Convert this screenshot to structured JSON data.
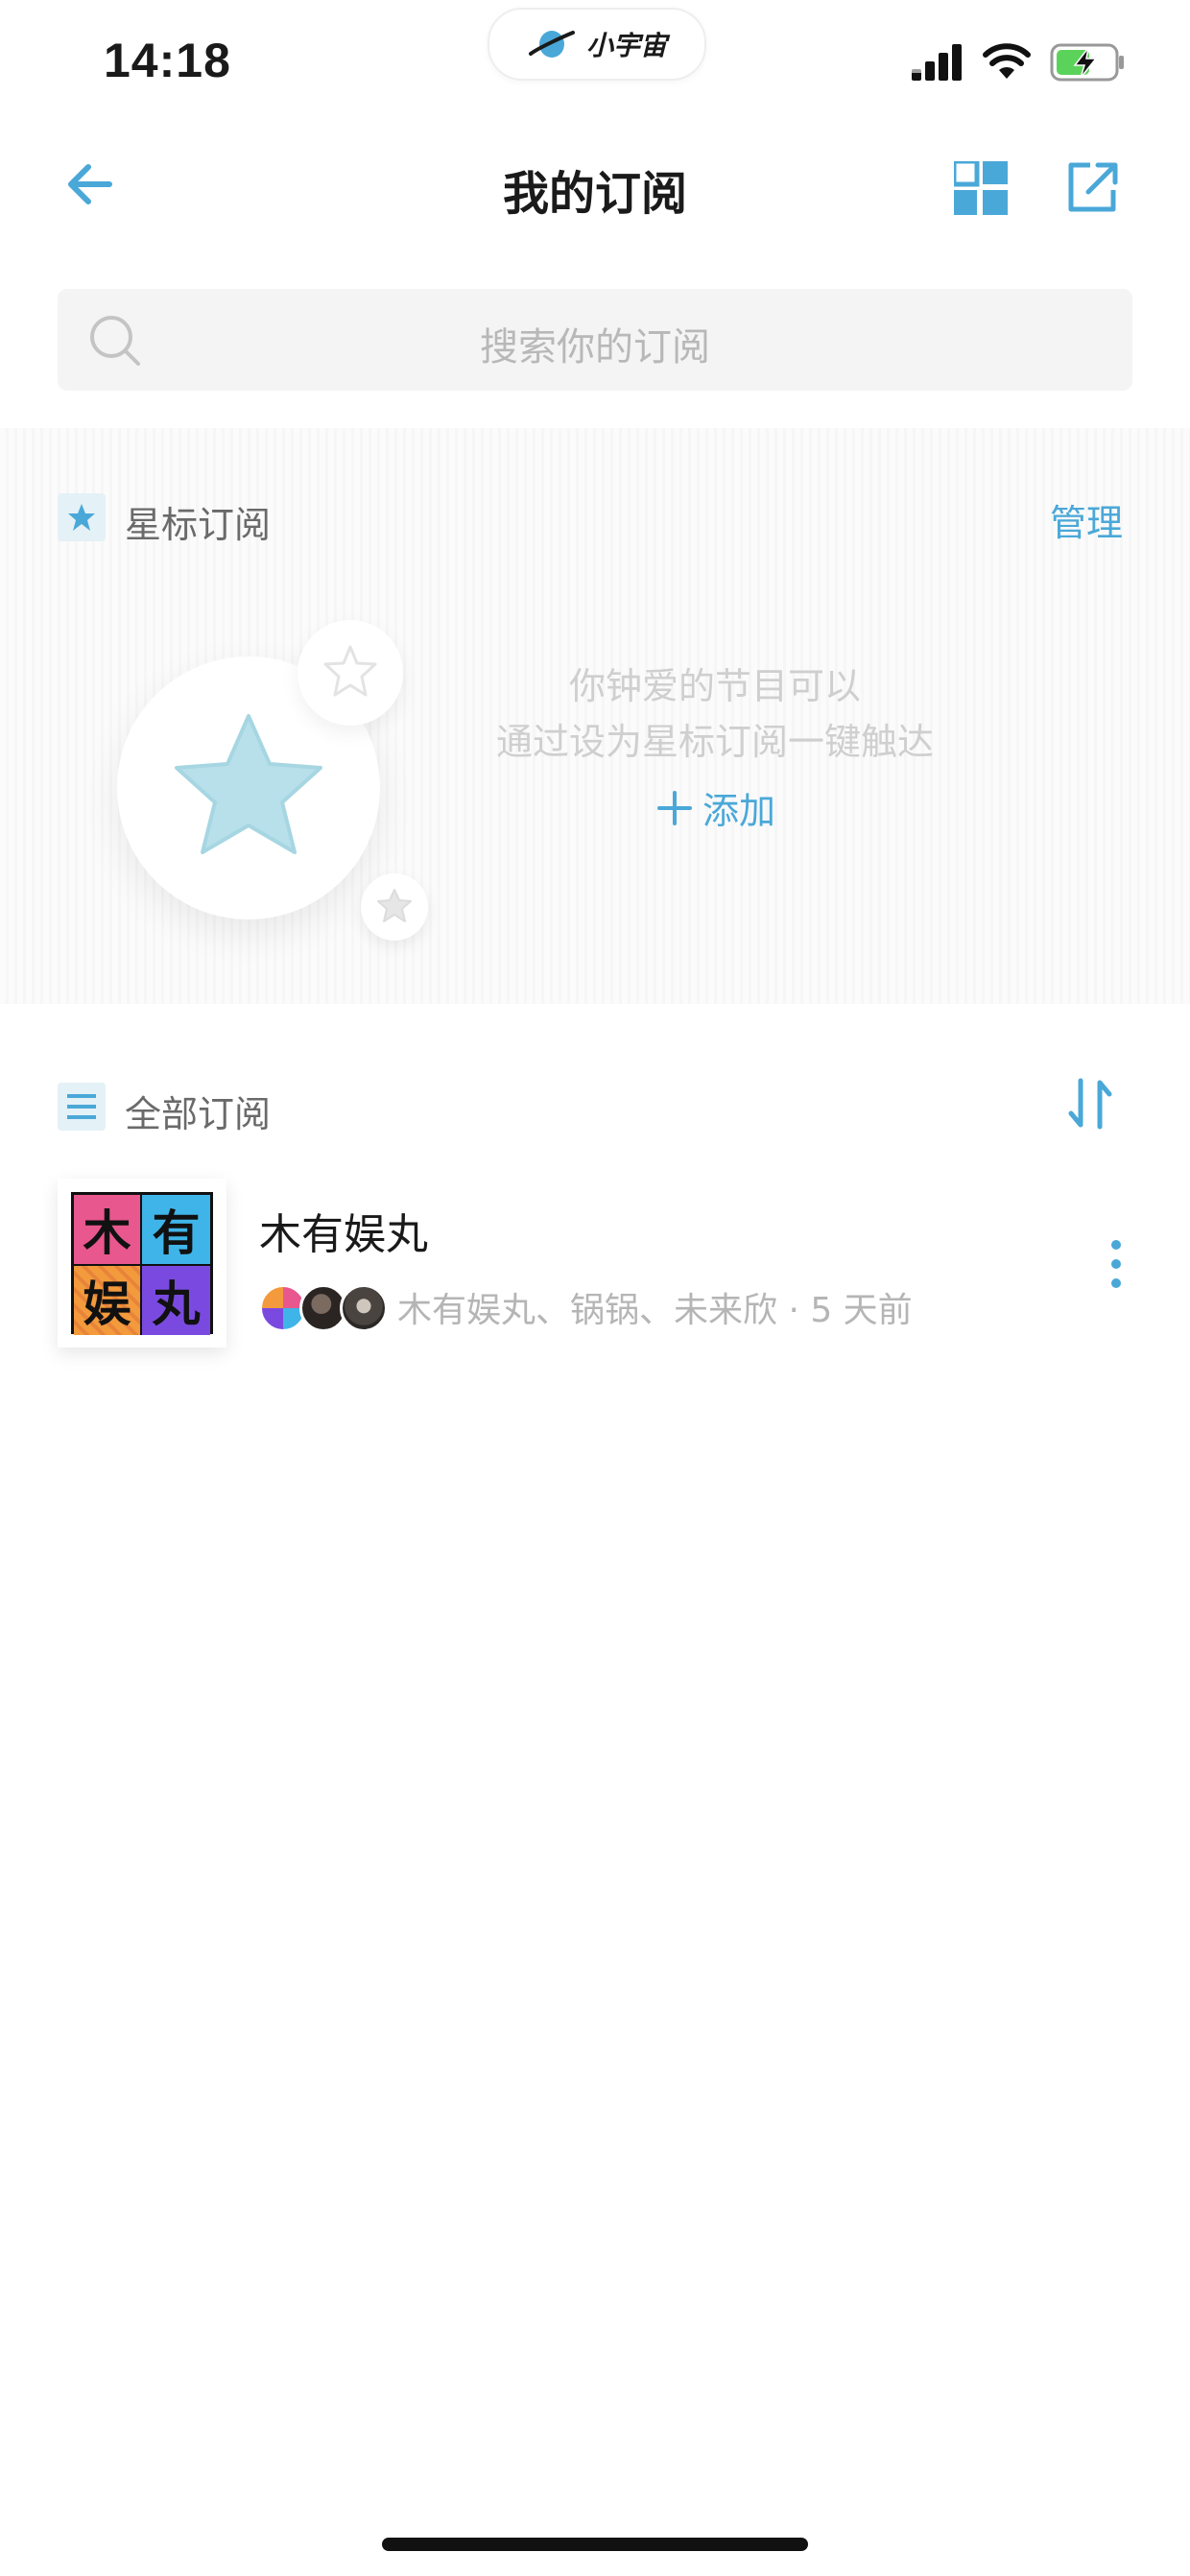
{
  "status_bar": {
    "time": "14:18",
    "app_pill_label": "小宇宙"
  },
  "header": {
    "title": "我的订阅"
  },
  "search": {
    "placeholder": "搜索你的订阅"
  },
  "starred": {
    "title": "星标订阅",
    "manage_label": "管理",
    "empty_line1": "你钟爱的节目可以",
    "empty_line2": "通过设为星标订阅一键触达",
    "add_label": "添加"
  },
  "all_subscriptions": {
    "title": "全部订阅",
    "items": [
      {
        "title": "木有娱丸",
        "cover_chars": [
          "木",
          "有",
          "娱",
          "丸"
        ],
        "meta": "木有娱丸、锅锅、未来欣 · 5 天前"
      }
    ]
  },
  "colors": {
    "accent": "#4aa8d8",
    "cover_pink": "#e8578e",
    "cover_blue": "#3fb4e8",
    "cover_orange": "#f39a3c",
    "cover_purple": "#7a4ae0"
  }
}
